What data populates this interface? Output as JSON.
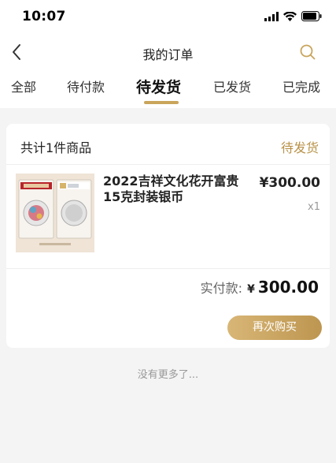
{
  "status_bar": {
    "time": "10:07"
  },
  "nav": {
    "title": "我的订单"
  },
  "tabs": [
    {
      "label": "全部"
    },
    {
      "label": "待付款"
    },
    {
      "label": "待发货",
      "active": true
    },
    {
      "label": "已发货"
    },
    {
      "label": "已完成"
    }
  ],
  "order": {
    "count_text": "共计1件商品",
    "status": "待发货",
    "goods_name": "2022吉祥文化花开富贵15克封装银币",
    "price": "¥300.00",
    "quantity": "x1",
    "paid_label": "实付款:",
    "paid_currency": "¥",
    "paid_amount": "300.00",
    "rebuy_label": "再次购买"
  },
  "footer": {
    "no_more": "没有更多了..."
  },
  "colors": {
    "accent": "#c9a55c",
    "status": "#b99248",
    "button_from": "#d8b676",
    "button_to": "#bd9650"
  }
}
